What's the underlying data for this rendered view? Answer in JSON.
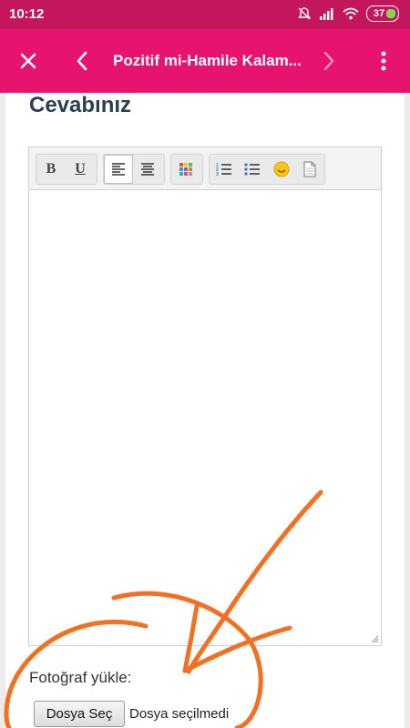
{
  "status": {
    "time": "10:12",
    "battery": "37"
  },
  "appbar": {
    "title": "Pozitif mi-Hamile Kalam..."
  },
  "page": {
    "heading": "Cevabınız"
  },
  "editor": {
    "toolbar": {
      "bold": "B",
      "underline": "U"
    }
  },
  "upload": {
    "label": "Fotoğraf yükle:",
    "button_label": "Dosya Seç",
    "status_text": "Dosya seçilmedi"
  },
  "colors": {
    "statusbar": "#c4165c",
    "appbar": "#e6136f",
    "heading": "#2c3e50",
    "scribble": "#f27022"
  }
}
